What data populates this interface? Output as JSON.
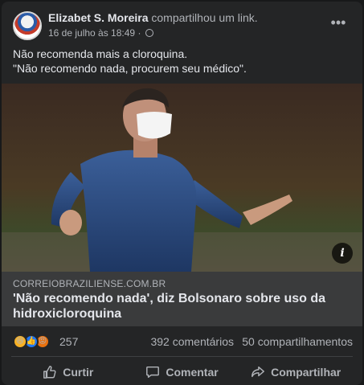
{
  "post": {
    "author": "Elizabet S. Moreira",
    "action": "compartilhou um link.",
    "timestamp": "16 de julho às 18:49",
    "separator": "·",
    "more_label": "•••",
    "text_lines": [
      "Não recomenda mais a cloroquina.",
      "\"Não recomendo nada, procurem seu médico\"."
    ]
  },
  "link_preview": {
    "domain": "CORREIOBRAZILIENSE.COM.BR",
    "title": "'Não recomendo nada', diz Bolsonaro sobre uso da hidroxicloroquina",
    "info_label": "i"
  },
  "stats": {
    "reactions": [
      {
        "icon": "haha-reaction-icon",
        "glyph": "😆",
        "color": "#f7b125"
      },
      {
        "icon": "like-reaction-icon",
        "glyph": "👍",
        "color": "#2078f4"
      },
      {
        "icon": "angry-reaction-icon",
        "glyph": "😡",
        "color": "#e9710f"
      }
    ],
    "reaction_count": "257",
    "comments": "392 comentários",
    "shares": "50 compartilhamentos"
  },
  "actions": {
    "like": "Curtir",
    "comment": "Comentar",
    "share": "Compartilhar"
  },
  "colors": {
    "card_bg": "#242526",
    "text_primary": "#e4e6eb",
    "text_secondary": "#b0b3b8",
    "link_bg": "#3a3b3c"
  }
}
